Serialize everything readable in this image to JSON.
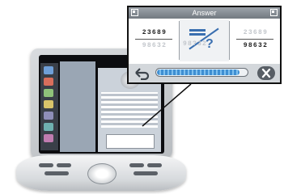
{
  "answer_panel": {
    "title": "Answer",
    "expand_icon_left": "expand-corner-icon",
    "expand_icon_right": "expand-corner-icon"
  },
  "tiles": [
    {
      "top": "23689",
      "bottom": "98632",
      "active": "top"
    },
    {
      "top": "",
      "bottom": "98?32",
      "icon": "equals-crossed-question-icon"
    },
    {
      "top": "23689",
      "bottom": "98632",
      "active": "bottom"
    }
  ],
  "controls": {
    "undo_icon": "undo-arrow-icon",
    "clear_icon": "clear-x-icon",
    "progress": 0.92
  },
  "colors": {
    "accent_blue": "#3a6fb0",
    "progress_fill": "#3f8fd2",
    "titlebar": "#858b92"
  }
}
